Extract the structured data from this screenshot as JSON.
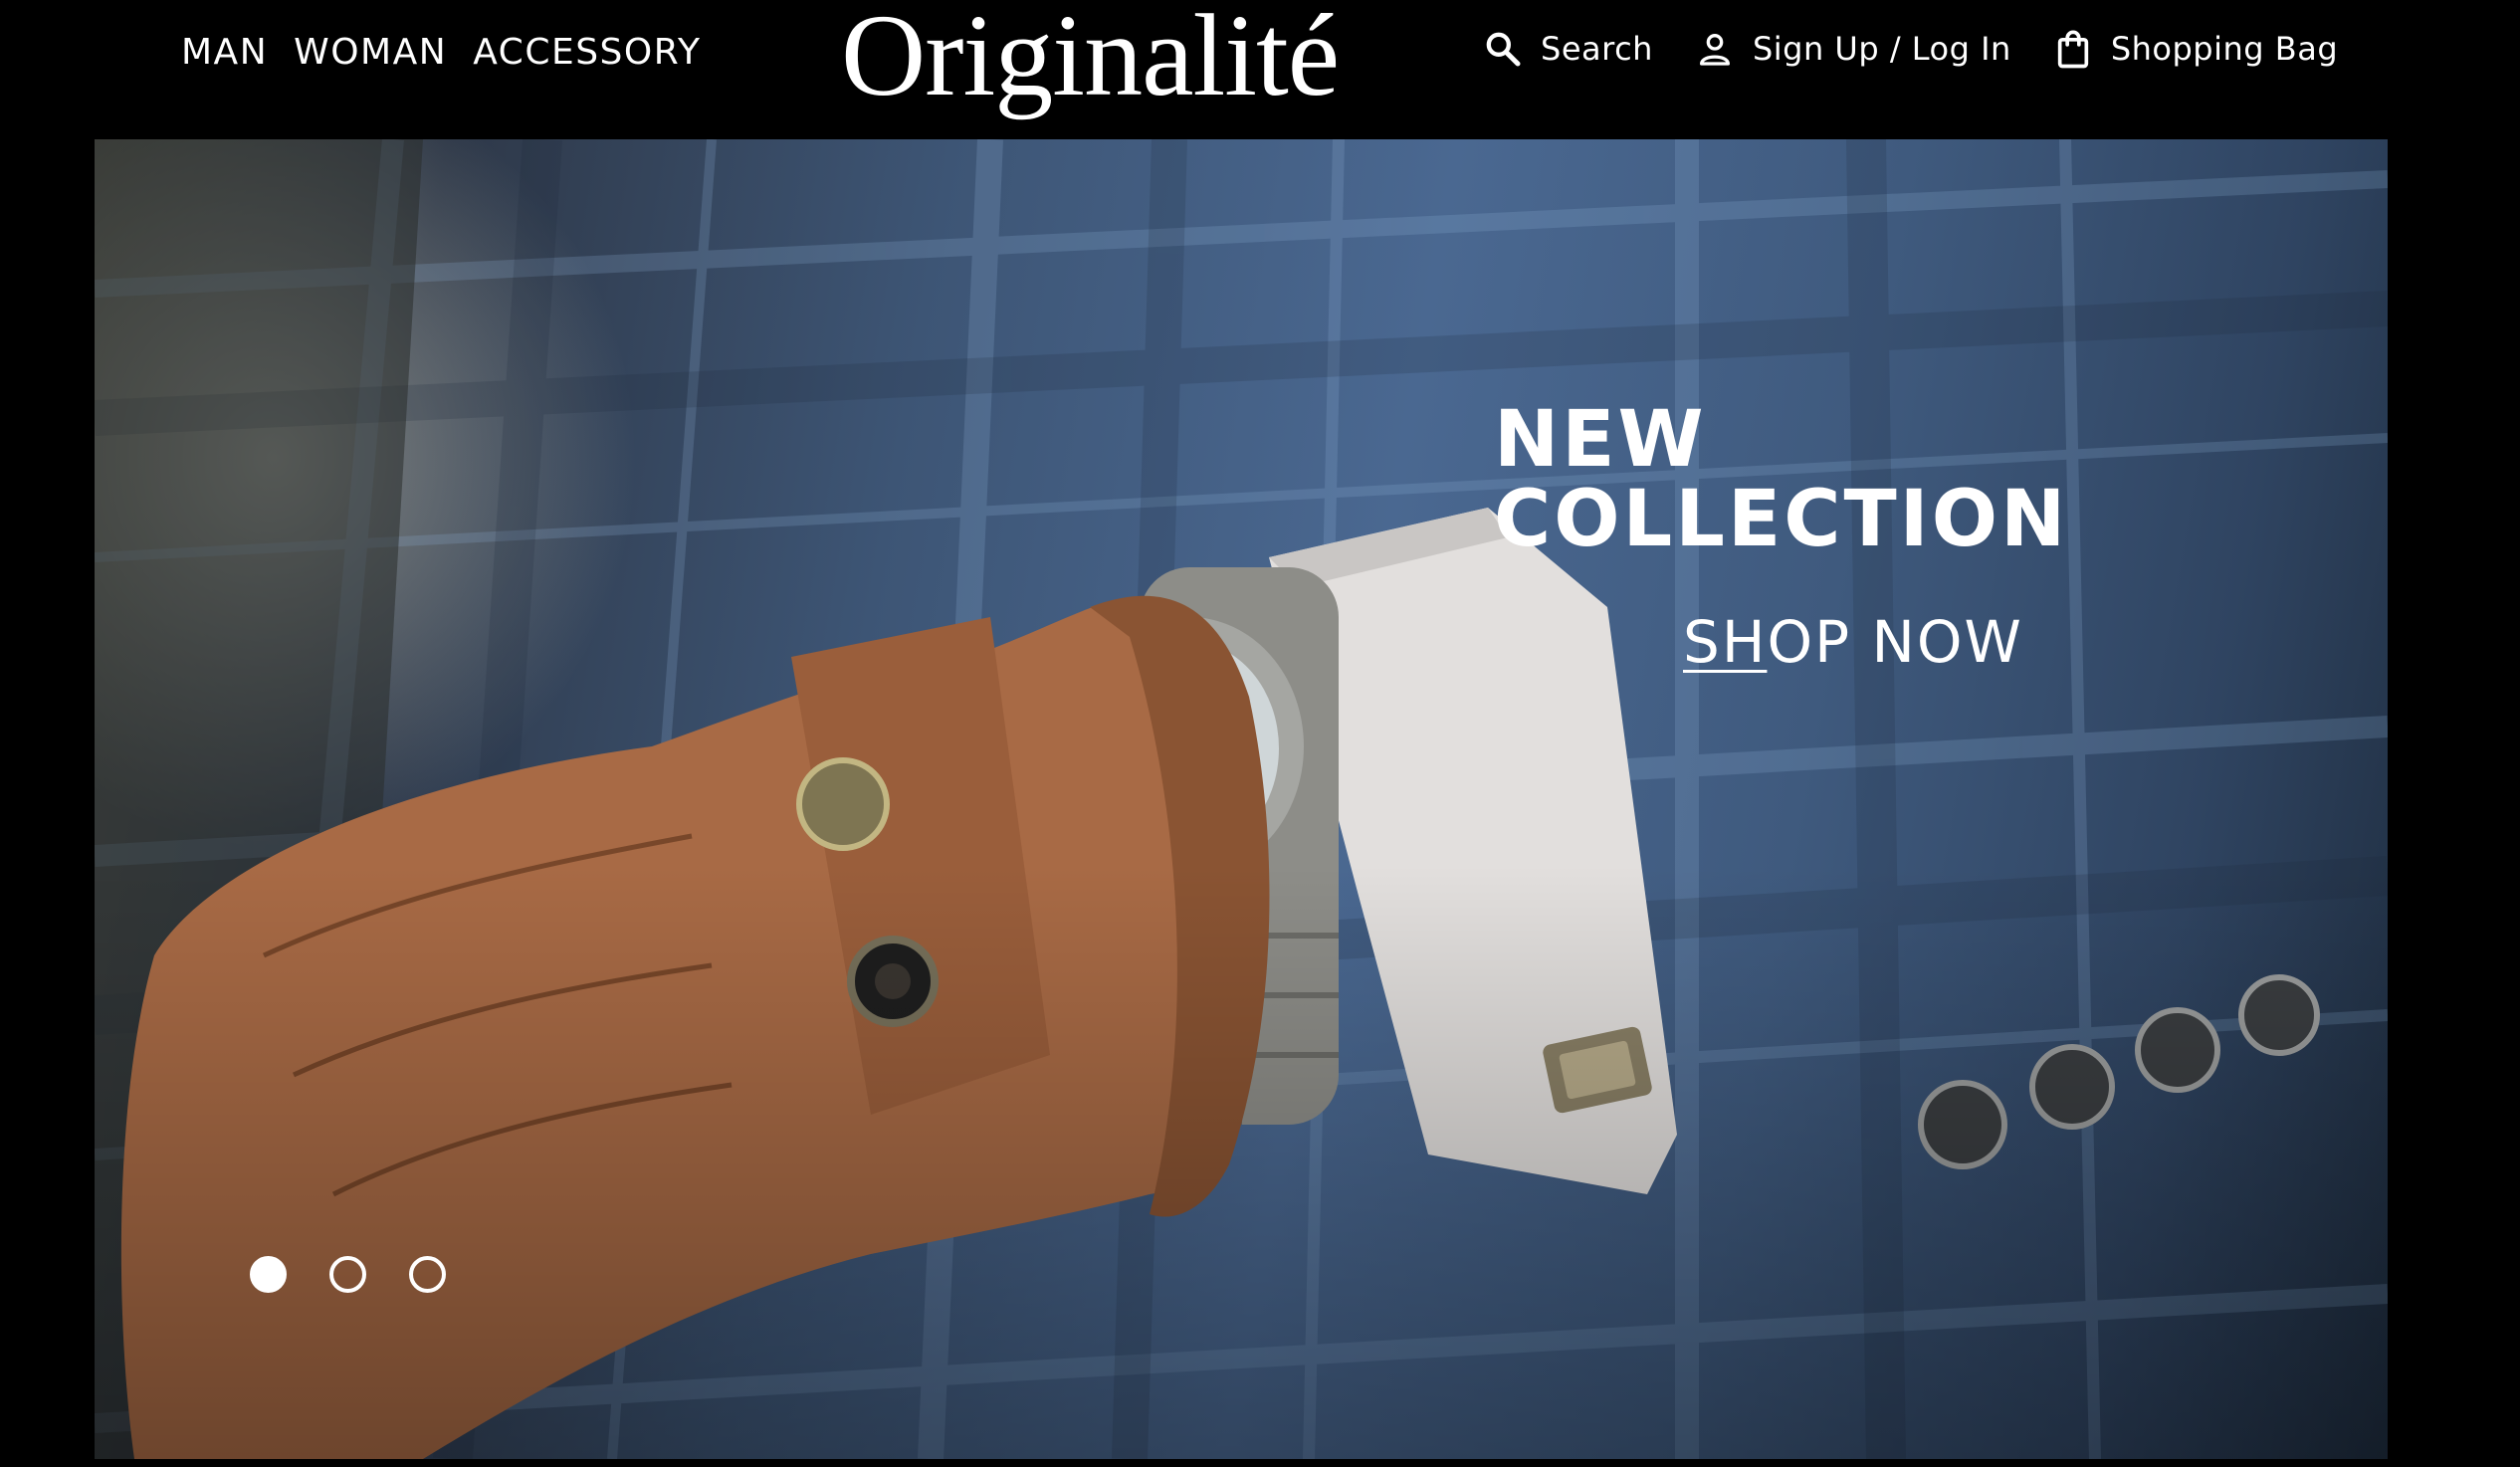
{
  "header": {
    "nav_left": [
      "MAN",
      "WOMAN",
      "ACCESSORY"
    ],
    "logo": "Originalité",
    "search_label": "Search",
    "account_label": "Sign Up / Log In",
    "bag_label": "Shopping Bag"
  },
  "hero": {
    "title_line1": "NEW",
    "title_line2": "COLLECTION",
    "cta_underlined": "SH",
    "cta_rest": "OP NOW",
    "image_subject": "gloved hand with wristwatch and plaid suit sleeve",
    "slides_total": 3,
    "active_slide": 1
  },
  "icons": {
    "search": "search-icon",
    "account": "user-icon",
    "bag": "shopping-bag-icon"
  },
  "colors": {
    "background": "#000000",
    "text": "#ffffff",
    "suit_blue": "#4a6891",
    "glove_brown": "#a86a45"
  }
}
